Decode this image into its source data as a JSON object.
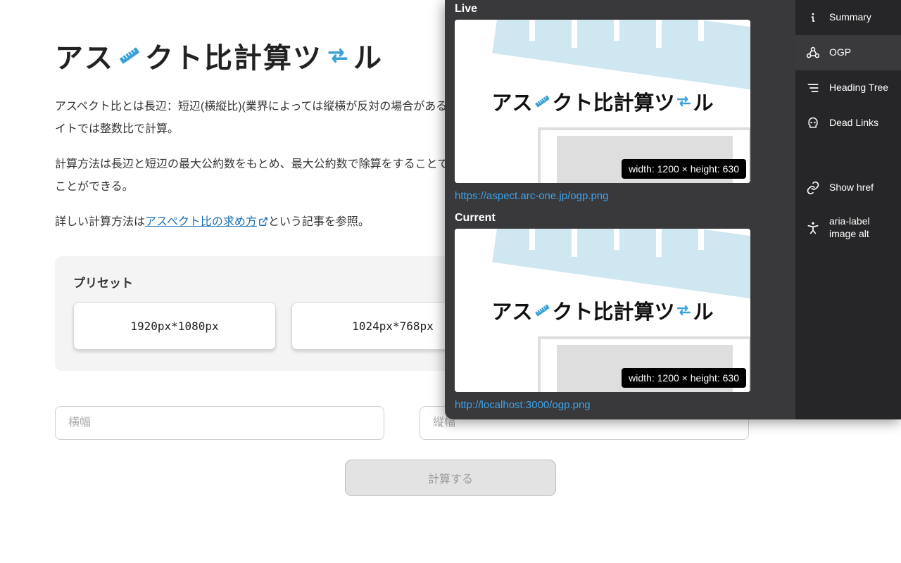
{
  "page": {
    "title_parts": {
      "a": "アス",
      "b": "クト比計算ツ",
      "c": "ル"
    },
    "description_1": "アスペクト比とは長辺：短辺(横縦比)(業界によっては縦横が反対の場合がある)ことが多く、紙などは1.618:1(黄金比)など小数点でも表わすことがある。本サイトでは整数比で計算。",
    "description_2": "計算方法は長辺と短辺の最大公約数をもとめ、最大公約数で除算をすることで最大公約数は2つ以上の整数に共通する約数(割り切れる数値)の中で一番大きいことができる。",
    "description_3_prefix": "詳しい計算方法は",
    "description_3_link": "アスペクト比の求め方",
    "description_3_suffix": "という記事を参照。",
    "preset_heading": "プリセット",
    "presets": [
      {
        "label": "1920px*1080px"
      },
      {
        "label": "1024px*768px"
      }
    ],
    "input_width_placeholder": "横幅",
    "input_height_placeholder": "縦幅",
    "calc_button_label": "計算する"
  },
  "overlay": {
    "live_label": "Live",
    "current_label": "Current",
    "dims_text": "width: 1200 × height: 630",
    "live_url": "https://aspect.arc-one.jp/ogp.png",
    "current_url": "http://localhost:3000/ogp.png",
    "preview_title_parts": {
      "a": "アス",
      "b": "クト比計算ツ",
      "c": "ル"
    },
    "nav": {
      "summary": "Summary",
      "ogp": "OGP",
      "heading_tree": "Heading Tree",
      "dead_links": "Dead Links",
      "show_href": "Show href",
      "aria": "aria-label\nimage alt"
    }
  },
  "colors": {
    "accent": "#3aa1d8",
    "ruler": "#bfe0ef",
    "link": "#1a6fb4"
  }
}
